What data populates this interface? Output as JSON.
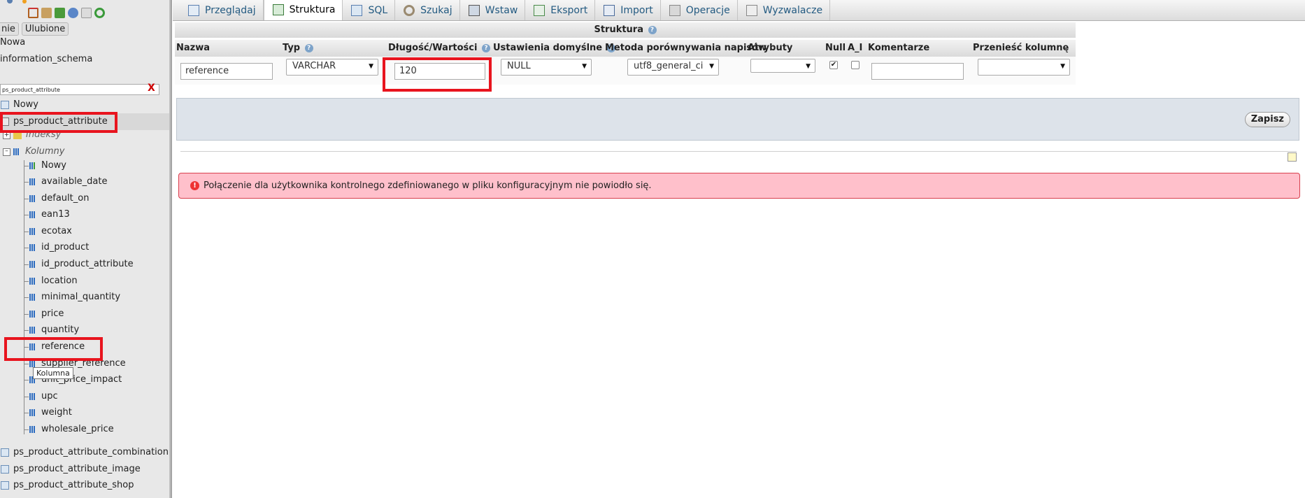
{
  "nav": {
    "tabs": [
      "nie",
      "Ulubione"
    ],
    "new_db": "Nowa",
    "db_name": "information_schema",
    "filter_value": "ps_product_attribute",
    "filter_clear": "X",
    "table_new": "Nowy",
    "selected_table": "ps_product_attribute",
    "indexes_label": "Indeksy",
    "columns_label": "Kolumny",
    "column_new": "Nowy",
    "columns": [
      "available_date",
      "default_on",
      "ean13",
      "ecotax",
      "id_product",
      "id_product_attribute",
      "location",
      "minimal_quantity",
      "price",
      "quantity",
      "reference",
      "supplier_reference",
      "unit_price_impact",
      "upc",
      "weight",
      "wholesale_price"
    ],
    "tooltip": "Kolumna",
    "other_tables": [
      "ps_product_attribute_combination",
      "ps_product_attribute_image",
      "ps_product_attribute_shop"
    ]
  },
  "topmenu": {
    "tabs": [
      {
        "label": "Przeglądaj",
        "icon": "browse-icon"
      },
      {
        "label": "Struktura",
        "icon": "structure-icon",
        "active": true
      },
      {
        "label": "SQL",
        "icon": "sql-icon"
      },
      {
        "label": "Szukaj",
        "icon": "search-icon"
      },
      {
        "label": "Wstaw",
        "icon": "insert-icon"
      },
      {
        "label": "Eksport",
        "icon": "export-icon"
      },
      {
        "label": "Import",
        "icon": "import-icon"
      },
      {
        "label": "Operacje",
        "icon": "operations-icon"
      },
      {
        "label": "Wyzwalacze",
        "icon": "triggers-icon"
      }
    ]
  },
  "structure": {
    "title": "Struktura",
    "headers": {
      "name": "Nazwa",
      "type": "Typ",
      "length": "Długość/Wartości",
      "default": "Ustawienia domyślne",
      "collation": "Metoda porównywania napisów",
      "attributes": "Atrybuty",
      "null": "Null",
      "ai": "A_I",
      "comments": "Komentarze",
      "move": "Przenieść kolumnę"
    },
    "row": {
      "name": "reference",
      "type": "VARCHAR",
      "length": "120",
      "default": "NULL",
      "collation": "utf8_general_ci",
      "attributes": "",
      "null_checked": true,
      "ai_checked": false,
      "comment": "",
      "move": ""
    },
    "save_label": "Zapisz"
  },
  "error_message": "Połączenie dla użytkownika kontrolnego zdefiniowanego w pliku konfiguracyjnym nie powiodło się.",
  "colors": {
    "highlight_red": "#e8141e",
    "error_bg": "#ffc0cb",
    "link_blue": "#235a81"
  }
}
